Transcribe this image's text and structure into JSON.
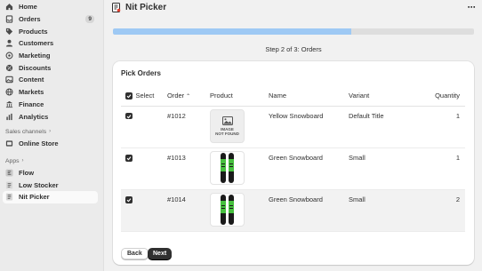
{
  "sidebar": {
    "items": [
      {
        "label": "Home",
        "icon": "home-icon"
      },
      {
        "label": "Orders",
        "icon": "orders-icon",
        "badge": "9"
      },
      {
        "label": "Products",
        "icon": "tag-icon"
      },
      {
        "label": "Customers",
        "icon": "person-icon"
      },
      {
        "label": "Marketing",
        "icon": "target-icon"
      },
      {
        "label": "Discounts",
        "icon": "discount-icon"
      },
      {
        "label": "Content",
        "icon": "content-icon"
      },
      {
        "label": "Markets",
        "icon": "globe-icon"
      },
      {
        "label": "Finance",
        "icon": "bank-icon"
      },
      {
        "label": "Analytics",
        "icon": "chart-icon"
      }
    ],
    "sales_channels_header": "Sales channels",
    "sales_channels": [
      {
        "label": "Online Store",
        "icon": "store-icon"
      }
    ],
    "apps_header": "Apps",
    "apps": [
      {
        "label": "Flow",
        "icon": "flow-app-icon"
      },
      {
        "label": "Low Stocker",
        "icon": "low-stocker-app-icon"
      },
      {
        "label": "Nit Picker",
        "icon": "nit-picker-app-icon",
        "selected": true
      }
    ]
  },
  "header": {
    "title": "Nit Picker",
    "more": "⋯"
  },
  "progress": {
    "fraction": 0.66,
    "fill_color": "#9ec9f4",
    "step_text": "Step 2 of 3: Orders"
  },
  "card": {
    "title": "Pick Orders",
    "columns": {
      "select": "Select",
      "order": "Order",
      "product": "Product",
      "name": "Name",
      "variant": "Variant",
      "quantity": "Quantity"
    },
    "rows": [
      {
        "order": "#1012",
        "image": "no-image",
        "image_text_1": "IMAGE",
        "image_text_2": "NOT FOUND",
        "name": "Yellow Snowboard",
        "variant": "Default Title",
        "quantity": "1",
        "checked": true
      },
      {
        "order": "#1013",
        "image": "green-snowboard",
        "name": "Green Snowboard",
        "variant": "Small",
        "quantity": "1",
        "checked": true
      },
      {
        "order": "#1014",
        "image": "green-snowboard",
        "name": "Green Snowboard",
        "variant": "Small",
        "quantity": "2",
        "checked": true,
        "highlighted": true
      }
    ],
    "back_label": "Back",
    "next_label": "Next"
  }
}
